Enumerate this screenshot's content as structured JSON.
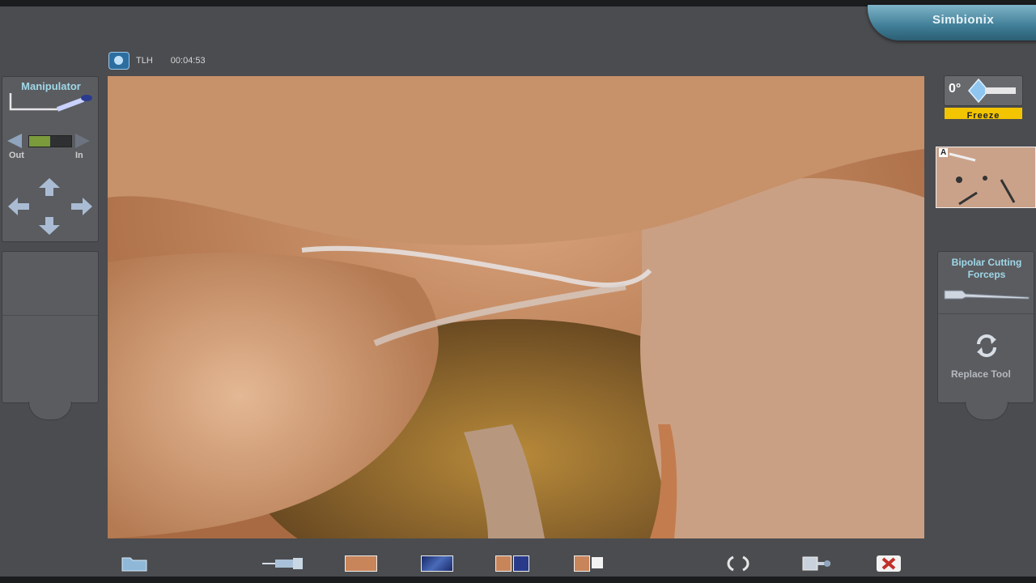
{
  "brand": "Simbionix",
  "status": {
    "procedure": "TLH",
    "timer": "00:04:53"
  },
  "left_panel": {
    "title": "Manipulator",
    "out_label": "Out",
    "in_label": "In",
    "zoom_level": 0.5
  },
  "right_panel": {
    "angle": "0°",
    "freeze_label": "Freeze",
    "map_marker": "A",
    "tool_name": "Bipolar Cutting Forceps",
    "replace_label": "Replace Tool"
  },
  "colors": {
    "accent_yellow": "#f3c400",
    "panel_text": "#9fd8e8"
  },
  "toolbar_icons": [
    "folder-icon",
    "syringe-tool-icon",
    "camera-view-icon",
    "video-view-icon",
    "split-view-icon",
    "dual-view-icon",
    "reset-icon",
    "exit-tool-icon",
    "close-icon"
  ]
}
